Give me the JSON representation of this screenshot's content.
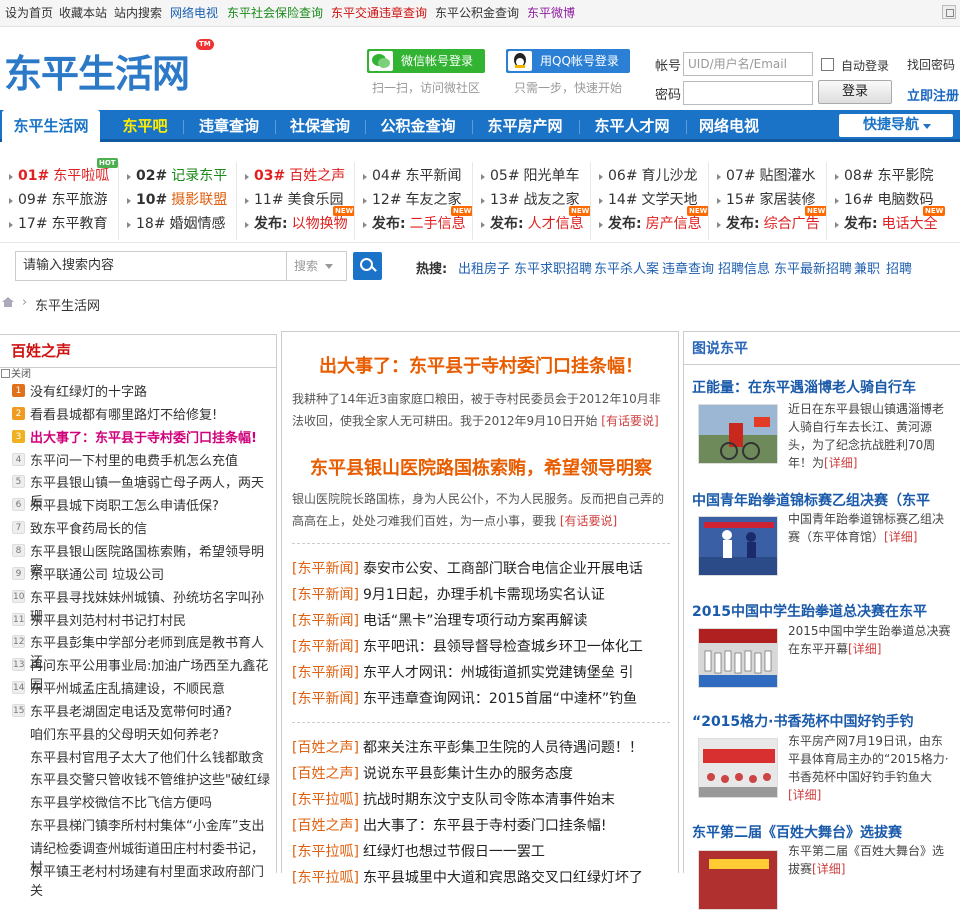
{
  "topbar": {
    "links": [
      {
        "label": "设为首页",
        "color": "#333333"
      },
      {
        "label": "收藏本站",
        "color": "#333333"
      },
      {
        "label": "站内搜索",
        "color": "#333333"
      },
      {
        "label": "网络电视",
        "color": "#1a5fb4"
      },
      {
        "label": "东平社会保险查询",
        "color": "#1a8a1a"
      },
      {
        "label": "东平交通违章查询",
        "color": "#d01010"
      },
      {
        "label": "东平公积金查询",
        "color": "#333333"
      },
      {
        "label": "东平微博",
        "color": "#8e1ea0"
      }
    ]
  },
  "header": {
    "logo": "东平生活网",
    "logo_tm": "TM",
    "wechat_login": "微信帐号登录",
    "wechat_sub": "扫一扫，访问微社区",
    "qq_login": "用QQ帐号登录",
    "qq_sub": "只需一步，快速开始",
    "account_label": "帐号",
    "account_placeholder": "UID/用户名/Email",
    "password_label": "密码",
    "auto_login": "自动登录",
    "find_password": "找回密码",
    "login_button": "登录",
    "register": "立即注册"
  },
  "nav": {
    "tabs": [
      "东平生活网",
      "东平吧",
      "违章查询",
      "社保查询",
      "公积金查询",
      "东平房产网",
      "东平人才网",
      "网络电视"
    ],
    "quick_nav": "快捷导航"
  },
  "links": [
    [
      {
        "num": "01#",
        "text": "东平啦呱",
        "style": "red",
        "badge": "HOT"
      },
      {
        "num": "09#",
        "text": "东平旅游",
        "style": "plain"
      },
      {
        "num": "17#",
        "text": "东平教育",
        "style": "plain"
      }
    ],
    [
      {
        "num": "02#",
        "text": "记录东平",
        "style": "green"
      },
      {
        "num": "10#",
        "text": "摄影联盟",
        "style": "org"
      },
      {
        "num": "18#",
        "text": "婚姻情感",
        "style": "plain"
      }
    ],
    [
      {
        "num": "03#",
        "text": "百姓之声",
        "style": "red"
      },
      {
        "num": "11#",
        "text": "美食乐园",
        "style": "plain"
      },
      {
        "num": "发布:",
        "text": "以物换物",
        "style": "post",
        "badge": "NEW"
      }
    ],
    [
      {
        "num": "04#",
        "text": "东平新闻",
        "style": "plain"
      },
      {
        "num": "12#",
        "text": "车友之家",
        "style": "plain"
      },
      {
        "num": "发布:",
        "text": "二手信息",
        "style": "post",
        "badge": "NEW"
      }
    ],
    [
      {
        "num": "05#",
        "text": "阳光单车",
        "style": "plain"
      },
      {
        "num": "13#",
        "text": "战友之家",
        "style": "plain"
      },
      {
        "num": "发布:",
        "text": "人才信息",
        "style": "post",
        "badge": "NEW"
      }
    ],
    [
      {
        "num": "06#",
        "text": "育儿沙龙",
        "style": "plain"
      },
      {
        "num": "14#",
        "text": "文学天地",
        "style": "plain"
      },
      {
        "num": "发布:",
        "text": "房产信息",
        "style": "post",
        "badge": "NEW"
      }
    ],
    [
      {
        "num": "07#",
        "text": "贴图灌水",
        "style": "plain"
      },
      {
        "num": "15#",
        "text": "家居装修",
        "style": "plain"
      },
      {
        "num": "发布:",
        "text": "综合广告",
        "style": "post",
        "badge": "NEW"
      }
    ],
    [
      {
        "num": "08#",
        "text": "东平影院",
        "style": "plain"
      },
      {
        "num": "16#",
        "text": "电脑数码",
        "style": "plain"
      },
      {
        "num": "发布:",
        "text": "电话大全",
        "style": "post",
        "badge": "NEW"
      }
    ]
  ],
  "search": {
    "placeholder": "请输入搜索内容",
    "scope": "搜索",
    "hot_label": "热搜:",
    "hot_keywords": [
      "出租房子",
      "东平求职招聘",
      "东平杀人案",
      "违章查询",
      "招聘信息",
      "东平最新招聘",
      "兼职",
      "招聘"
    ]
  },
  "breadcrumb": {
    "current": "东平生活网"
  },
  "left_panel": {
    "title": "百姓之声",
    "close_label": "关闭",
    "items": [
      "没有红绿灯的十字路",
      "看看县城都有哪里路灯不给修复!",
      "出大事了：东平县于寺村委门口挂条幅!",
      "东平问一下村里的电费手机怎么充值",
      "东平县银山镇一鱼塘弱亡母子两人，两天后",
      "东平县城下岗职工怎么申请低保?",
      "致东平食药局长的信",
      "东平县银山医院路国栋索贿，希望领导明察",
      "东平联通公司  垃圾公司",
      "东平县寻找妹妹州城镇、孙统坊名字叫孙珊",
      "东平县刘范村村书记打村民",
      "东平县彭集中学部分老师到底是教书育人还",
      "再问东平公用事业局:加油广场西至九鑫花园",
      "东平州城孟庄乱搞建设，不顺民意",
      "东平县老湖固定电话及宽带何时通?",
      "咱们东平县的父母明天如何养老?",
      "东平县村官甩子太大了他们什么钱都敢贪",
      "东平县交警只管收钱不管维护这些\"破红绿",
      "东平县学校微信不比飞信方便吗",
      "东平县梯门镇李所村村集体“小金库”支出",
      "请纪检委调查州城街道田庄村村委书记，村",
      "东平镇王老村村场建有村里面求政府部门关"
    ]
  },
  "mid_panel": {
    "head1": "出大事了：东平县于寺村委门口挂条幅！",
    "summary1": "我耕种了14年近3亩家庭口粮田，被于寺村民委员会于2012年10月非法收回，使我全家人无可耕田。我于2012年9月10日开始",
    "more1": "[有话要说]",
    "head2": "东平县银山医院路国栋索贿，希望领导明察",
    "summary2": "银山医院院长路国栋，身为人民公仆，不为人民服务。反而把自己弄的高高在上，处处刁难我们百姓，为一点小事，要我",
    "more2": "[有话要说]",
    "news_a": [
      {
        "cat": "[东平新闻]",
        "text": "泰安市公安、工商部门联合电信企业开展电话"
      },
      {
        "cat": "[东平新闻]",
        "text": "9月1日起，办理手机卡需现场实名认证"
      },
      {
        "cat": "[东平新闻]",
        "text": "电话“黑卡”治理专项行动方案再解读"
      },
      {
        "cat": "[东平新闻]",
        "text": "东平吧讯：县领导督导检查城乡环卫一体化工"
      },
      {
        "cat": "[东平新闻]",
        "text": "东平人才网讯：州城街道抓实党建铸堡垒  引"
      },
      {
        "cat": "[东平新闻]",
        "text": "东平违章查询网讯：2015首届“中達杯”钓鱼"
      }
    ],
    "news_b": [
      {
        "cat": "[百姓之声]",
        "text": "都来关注东平彭集卫生院的人员待遇问题！！"
      },
      {
        "cat": "[百姓之声]",
        "text": "说说东平县彭集计生办的服务态度"
      },
      {
        "cat": "[东平拉呱]",
        "text": "抗战时期东汶宁支队司令陈本清事件始末"
      },
      {
        "cat": "[百姓之声]",
        "text": "出大事了：东平县于寺村委门口挂条幅!"
      },
      {
        "cat": "[东平拉呱]",
        "text": "红绿灯也想过节假日一一罢工"
      },
      {
        "cat": "[东平拉呱]",
        "text": "东平县城里中大道和宾思路交叉口红绿灯坏了"
      }
    ]
  },
  "right_panel": {
    "title": "图说东平",
    "items": [
      {
        "title": "正能量：在东平遇淄博老人骑自行车",
        "text": "近日在东平县银山镇遇淄博老人骑自行车去长江、黄河源头，为了纪念抗战胜利70周年！为",
        "more": "[详细]"
      },
      {
        "title": "中国青年跆拳道锦标赛乙组决赛（东平",
        "text": "中国青年跆拳道锦标赛乙组决赛（东平体育馆）",
        "more": "[详细]"
      },
      {
        "title": "2015中国中学生跆拳道总决赛在东平",
        "text": "2015中国中学生跆拳道总决赛在东平开幕",
        "more": "[详细]"
      },
      {
        "title": "“2015格力·书香苑杯中国好钓手钓",
        "text": "东平房产网7月19日讯，由东平县体育局主办的“2015格力·书香苑杯中国好钓手钓鱼大",
        "more": "[详细]"
      },
      {
        "title": "东平第二届《百姓大舞台》选拔赛",
        "text": "东平第二届《百姓大舞台》选拔赛",
        "more": "[详细]"
      }
    ]
  }
}
